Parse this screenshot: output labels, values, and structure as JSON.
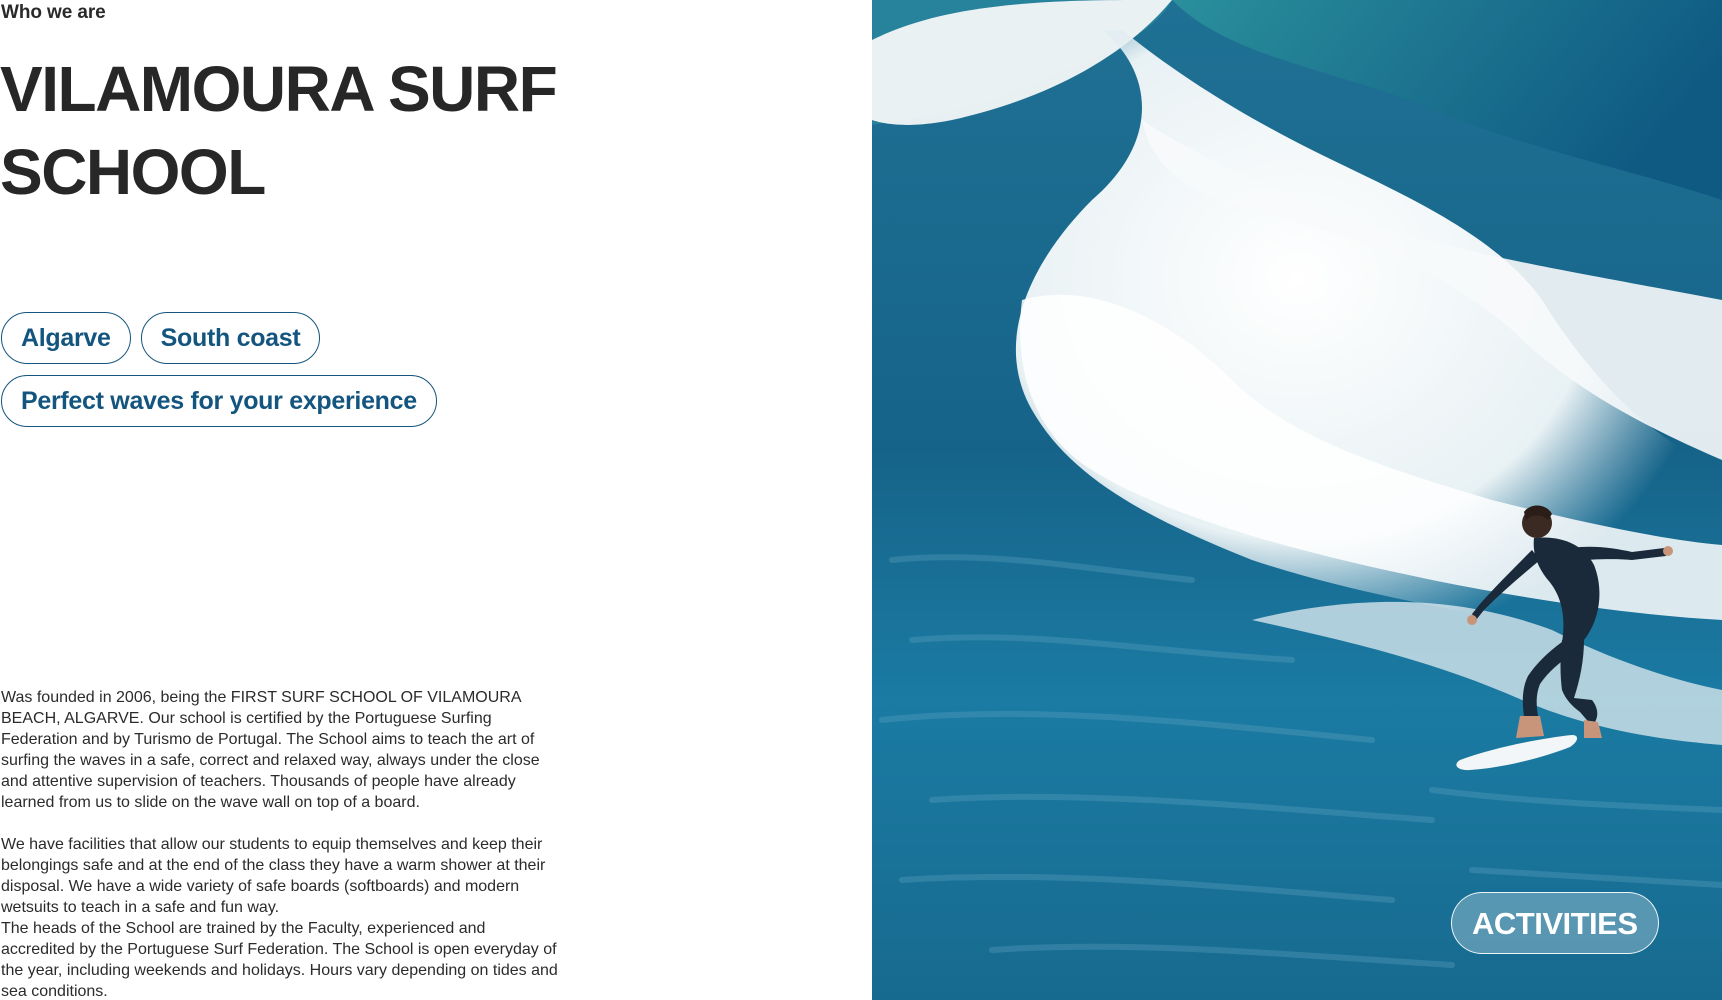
{
  "section": {
    "eyebrow": "Who we are",
    "title": "VILAMOURA SURF SCHOOL"
  },
  "tags": [
    "Algarve",
    "South coast",
    "Perfect waves for your experience"
  ],
  "description": [
    "Was founded in 2006, being the FIRST SURF SCHOOL OF VILAMOURA BEACH, ALGARVE. Our school is certified by the Portuguese Surfing Federation and by Turismo de Portugal. The School aims to teach the art of surfing the waves in a safe, correct and relaxed way, always under the close and attentive supervision of teachers. Thousands of people have already learned from us to slide on the wave wall on top of a board.",
    "We have facilities that allow our students to equip themselves and keep their belongings safe and at the end of the class they have a warm shower at their disposal. We have a wide variety of safe boards (softboards) and modern wetsuits to teach in a safe and fun way.",
    "The heads of the School are trained by the Faculty, experienced and accredited by the Portuguese Surf Federation. The School is open everyday of the year, including weekends and holidays. Hours vary depending on tides and sea conditions."
  ],
  "hero": {
    "image_icon": "surfer-wave-photo",
    "cta_label": "ACTIVITIES"
  },
  "colors": {
    "accent": "#14557f",
    "heading": "#272727",
    "ocean": "#1a6f93",
    "foam": "#ffffff"
  }
}
